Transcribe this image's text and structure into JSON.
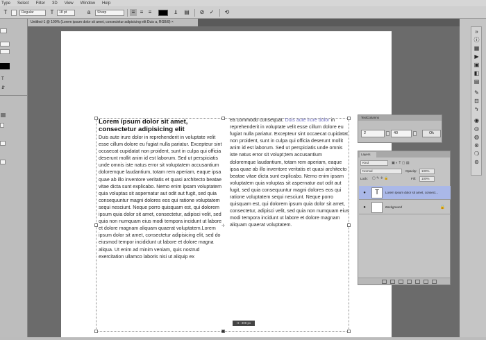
{
  "menu": [
    "Type",
    "Select",
    "Filter",
    "3D",
    "View",
    "Window",
    "Help"
  ],
  "options": {
    "font_style": "Regular",
    "font_size": "18 pt",
    "antialias": "Sharp"
  },
  "document_tab": "Untitled-1 @ 100% (Lorem ipsum dolor sit amet, consectetur adipisicing elit Duis a, RGB/8) ×",
  "text": {
    "heading": "Lorem ipsum dolor sit amet, consectetur adipisicing elit",
    "col1_body": "Duis aute irure dolor in reprehenderit in voluptate velit esse cillum dolore eu fugiat nulla pariatur. Excepteur sint occaecat cupidatat non proident, sunt in culpa qui officia deserunt mollit anim id est laborum. Sed ut perspiciatis unde omnis iste natus error sit voluptatem accusantium doloremque laudantium, totam rem aperiam, eaque ipsa quae ab illo inventore veritatis et quasi architecto beatae vitae dicta sunt explicabo. Nemo enim ipsam voluptatem quia voluptas sit aspernatur aut odit aut fugit, sed quia consequuntur magni dolores eos qui ratione voluptatem sequi nesciunt. Neque porro quisquam est, qui dolorem ipsum quia dolor sit amet, consectetur, adipisci velit, sed quia non numquam eius modi tempora incidunt ut labore et dolore magnam aliquam quaerat voluptatem.Lorem ipsum dolor sit amet, consectetur adipisicing elit, sed do eiusmod tempor incididunt ut labore et dolore magna aliqua. Ut enim ad minim veniam, quis nostrud exercitation ullamco laboris nisi ut aliquip ex",
    "col2_lead": "ea commodo consequat.",
    "col2_highlight": " Duis aute irure dolor",
    "col2_body": " in reprehenderit in voluptate velit esse cillum dolore eu fugiat nulla pariatur. Excepteur sint occaecat cupidatat non proident, sunt in culpa qui officia deserunt mollit anim id est laborum. Sed ut perspiciatis unde omnis iste natus error sit volupt;tem accusantium doloremque laudantium, totam rem aperiam, eaque ipsa quae ab illo inventore veritatis et quasi architecto beatae vitae dicta sunt explicabo. Nemo enim ipsam voluptatem quia voluptas sit aspernatur aut odit aut fugit, sed quia consequuntur magni dolores eos qui ratione voluptatem sequi nesciunt. Neque porro quisquam est, qui dolorem ipsum quia dolor sit amet, consectetur, adipisci velit, sed quia non numquam eius modi tempora incidunt ut labore et dolore magnam aliquam quaerat voluptatem."
  },
  "size_tooltip": "H : 308 px",
  "text_columns_panel": {
    "title": "TextColumns",
    "columns": "2",
    "gutter": "40",
    "ok": "Ok"
  },
  "layers_panel": {
    "tab": "Layers",
    "kind": "Kind",
    "blend_mode": "Normal",
    "opacity_label": "Opacity:",
    "opacity": "100%",
    "lock_label": "Lock:",
    "fill_label": "Fill:",
    "fill": "100%",
    "layers": [
      {
        "name": "Lorem ipsum dolor sit amet, consect...",
        "type": "text",
        "selected": true
      },
      {
        "name": "Background",
        "type": "background",
        "selected": false
      }
    ]
  },
  "colors": {
    "workspace": "#6b6b6b",
    "selected_layer": "#aab8e8",
    "text_highlight": "#7070c0"
  }
}
